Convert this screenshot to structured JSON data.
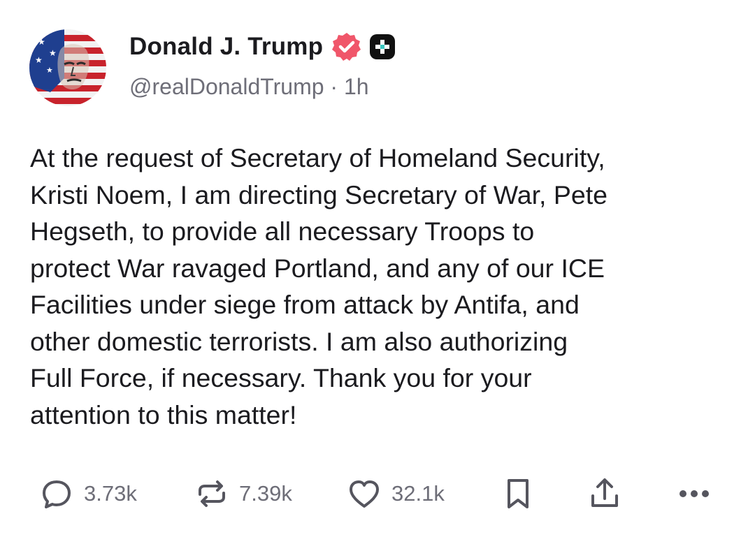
{
  "author": {
    "display_name": "Donald J. Trump",
    "handle": "@realDonaldTrump",
    "separator": "·",
    "time": "1h",
    "avatar_icon": "flag-portrait-avatar",
    "verified_icon": "verified-badge-icon",
    "verified_color": "#f0566a",
    "plus_icon": "plus-badge-icon"
  },
  "post": {
    "text": "At the request of Secretary of Homeland Security,\nKristi Noem, I am directing Secretary of War, Pete\nHegseth, to provide all necessary Troops to\nprotect War ravaged Portland, and any of our ICE\nFacilities under siege from attack by Antifa, and\nother domestic terrorists. I am also authorizing\nFull Force, if necessary. Thank you for your\nattention to this matter!"
  },
  "actions": {
    "reply": {
      "icon": "reply-bubble-icon",
      "count": "3.73k"
    },
    "repost": {
      "icon": "repost-icon",
      "count": "7.39k"
    },
    "like": {
      "icon": "heart-icon",
      "count": "32.1k"
    },
    "bookmark": {
      "icon": "bookmark-icon"
    },
    "share": {
      "icon": "share-upload-icon"
    },
    "more": {
      "icon": "more-dots-icon"
    }
  },
  "colors": {
    "text": "#1b1b1f",
    "muted": "#6e6e78",
    "icon": "#55555e"
  }
}
